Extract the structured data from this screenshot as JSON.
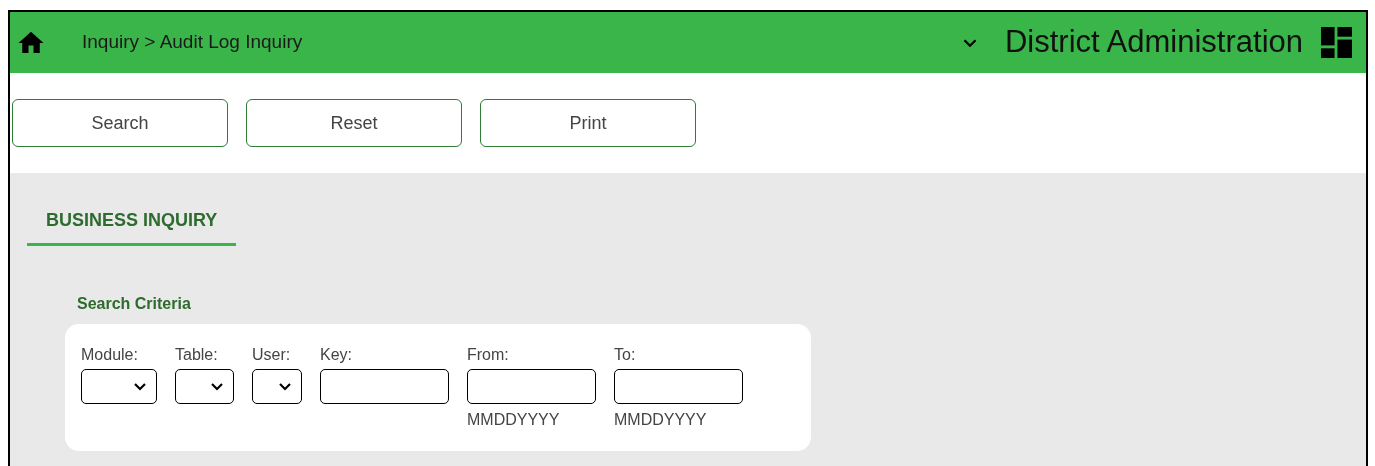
{
  "header": {
    "breadcrumb": "Inquiry > Audit Log Inquiry",
    "title": "District Administration"
  },
  "buttons": [
    "Search",
    "Reset",
    "Print"
  ],
  "tabs": [
    {
      "label": "BUSINESS INQUIRY",
      "selected": true
    }
  ],
  "section": {
    "title": "Search Criteria"
  },
  "fields": [
    {
      "label": "Module:",
      "kind": "select"
    },
    {
      "label": "Table:",
      "kind": "select"
    },
    {
      "label": "User:",
      "kind": "select"
    },
    {
      "label": "Key:",
      "kind": "text"
    },
    {
      "label": "From:",
      "kind": "text",
      "hint": "MMDDYYYY"
    },
    {
      "label": "To:",
      "kind": "text",
      "hint": "MMDDYYYY"
    }
  ]
}
